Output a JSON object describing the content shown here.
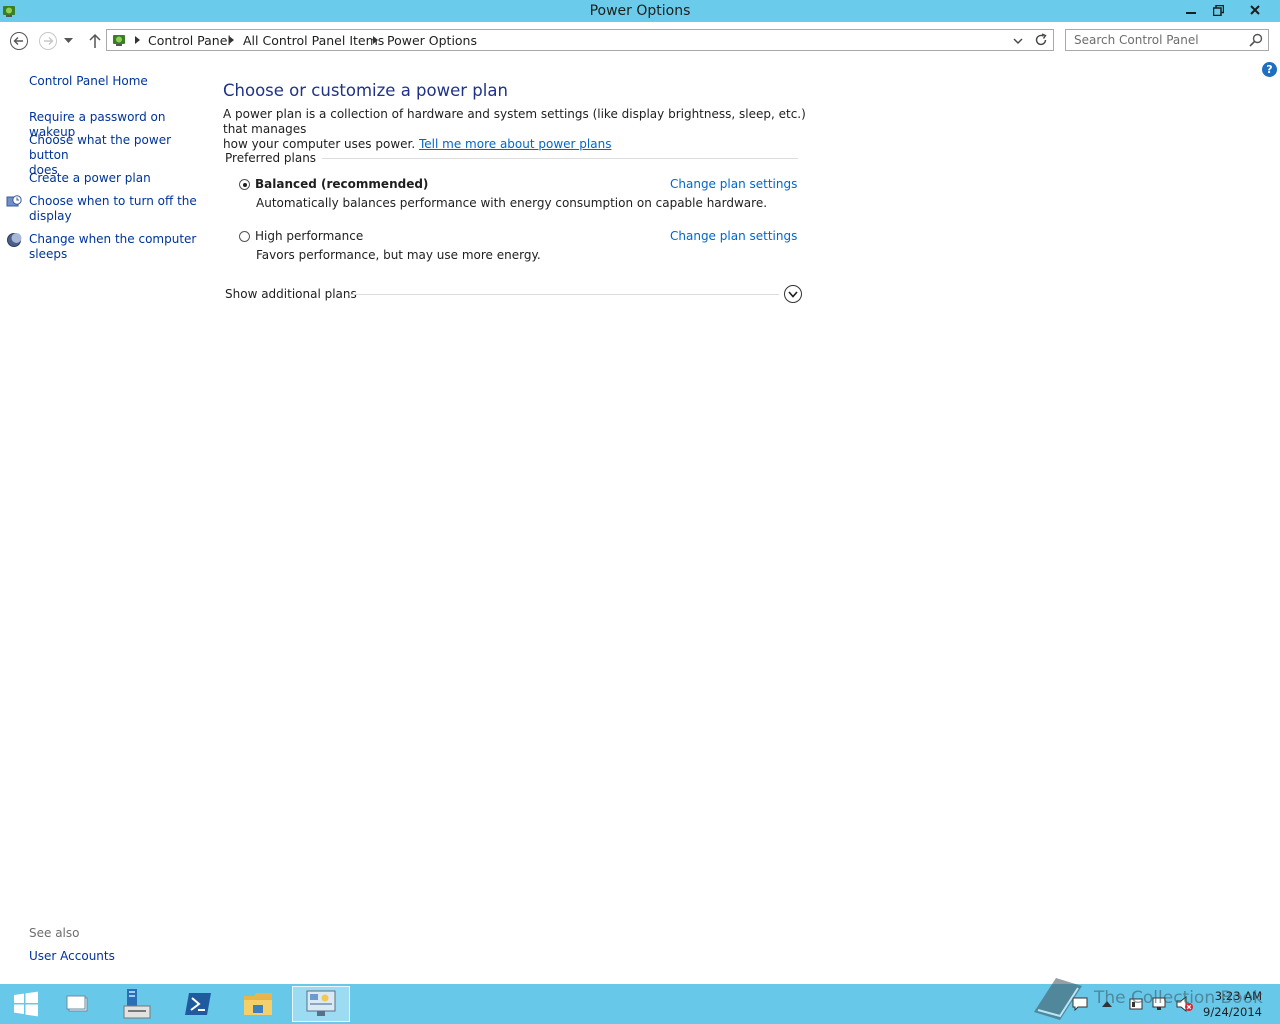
{
  "window": {
    "title": "Power Options"
  },
  "breadcrumb": [
    "Control Panel",
    "All Control Panel Items",
    "Power Options"
  ],
  "search": {
    "placeholder": "Search Control Panel"
  },
  "sidebar": {
    "home": "Control Panel Home",
    "links": [
      {
        "label_line1": "Require a password on wakeup",
        "label_line2": ""
      },
      {
        "label_line1": "Choose what the power button",
        "label_line2": "does"
      },
      {
        "label_line1": "Create a power plan",
        "label_line2": ""
      },
      {
        "label_line1": "Choose when to turn off the",
        "label_line2": "display",
        "icon": "display-icon"
      },
      {
        "label_line1": "Change when the computer",
        "label_line2": "sleeps",
        "icon": "moon-icon"
      }
    ],
    "see_also_title": "See also",
    "see_also_links": [
      "User Accounts"
    ]
  },
  "main": {
    "heading": "Choose or customize a power plan",
    "intro_line1": "A power plan is a collection of hardware and system settings (like display brightness, sleep, etc.) that manages",
    "intro_line2": "how your computer uses power.",
    "intro_link": "Tell me more about power plans",
    "group_header": "Preferred plans",
    "plans": [
      {
        "name": "Balanced (recommended)",
        "description": "Automatically balances performance with energy consumption on capable hardware.",
        "link": "Change plan settings",
        "selected": true
      },
      {
        "name": "High performance",
        "description": "Favors performance, but may use more energy.",
        "link": "Change plan settings",
        "selected": false
      }
    ],
    "show_additional": "Show additional plans"
  },
  "taskbar": {
    "time": "3:23 AM",
    "date": "9/24/2014",
    "watermark": "The Collection Book"
  },
  "colors": {
    "titlebar": "#6bcbea",
    "taskbar": "#67c8ea",
    "heading": "#1e3287",
    "link": "#0066cc",
    "sidebar_link": "#003399"
  }
}
